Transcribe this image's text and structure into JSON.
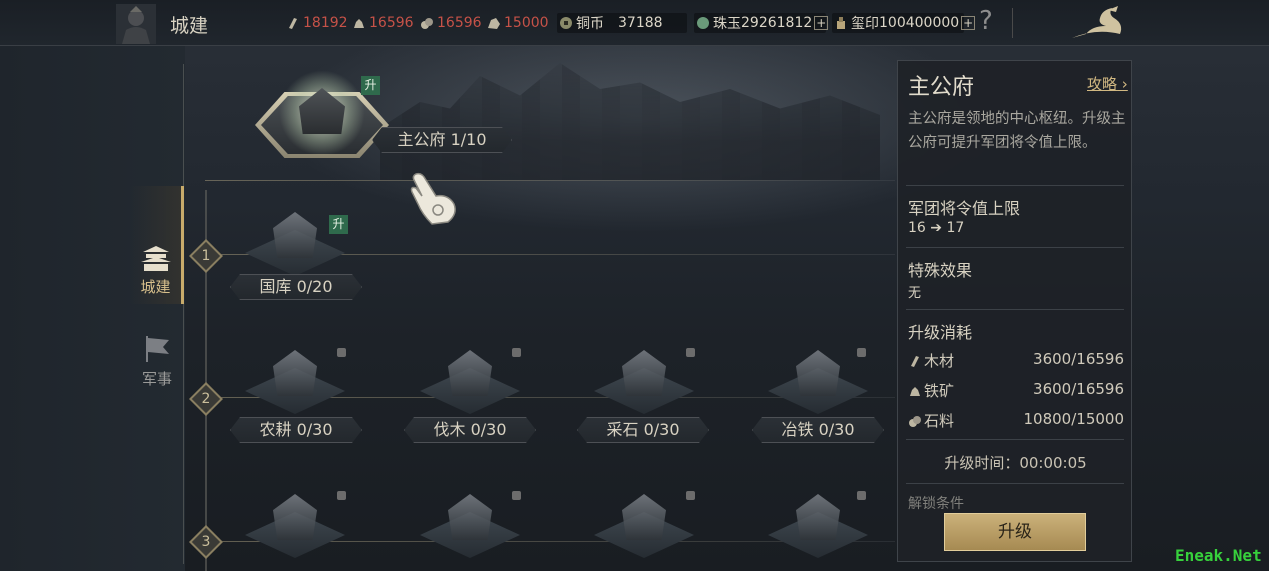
{
  "header": {
    "title": "城建",
    "resources": [
      {
        "icon": "wood-icon",
        "value": "18192"
      },
      {
        "icon": "iron-ore-icon",
        "value": "16596"
      },
      {
        "icon": "stone-icon",
        "value": "16596"
      },
      {
        "icon": "food-icon",
        "value": "15000"
      }
    ],
    "copper_label": "铜币",
    "copper_value": "37188",
    "jade_label": "珠玉",
    "jade_value": "29261812",
    "seal_label": "玺印",
    "seal_value": "100400000",
    "plus": "+",
    "help": "?"
  },
  "side_nav": [
    {
      "label": "城建",
      "icon": "city-build-icon",
      "active": true
    },
    {
      "label": "军事",
      "icon": "military-flag-icon",
      "active": false
    }
  ],
  "main_hall": {
    "label": "主公府 1/10",
    "badge": "升"
  },
  "tiers": [
    "1",
    "2",
    "3"
  ],
  "tier1": [
    {
      "label": "国库 0/20",
      "badge": "升"
    }
  ],
  "tier2": [
    {
      "label": "农耕 0/30"
    },
    {
      "label": "伐木 0/30"
    },
    {
      "label": "采石 0/30"
    },
    {
      "label": "冶铁 0/30"
    }
  ],
  "panel": {
    "title": "主公府",
    "guide": "攻略",
    "description": "主公府是领地的中心枢纽。升级主公府可提升军团将令值上限。",
    "cap_title": "军团将令值上限",
    "cap_from": "16",
    "cap_arrow": "➔",
    "cap_to": "17",
    "special_title": "特殊效果",
    "special_value": "无",
    "cost_title": "升级消耗",
    "costs": [
      {
        "icon": "wood-icon",
        "name": "木材",
        "value": "3600/16596"
      },
      {
        "icon": "iron-ore-icon",
        "name": "铁矿",
        "value": "3600/16596"
      },
      {
        "icon": "stone-icon",
        "name": "石料",
        "value": "10800/15000"
      }
    ],
    "time_label": "升级时间：00:00:05",
    "cut_text": "解锁条件",
    "upgrade_button": "升级"
  },
  "watermark": "Eneak.Net"
}
